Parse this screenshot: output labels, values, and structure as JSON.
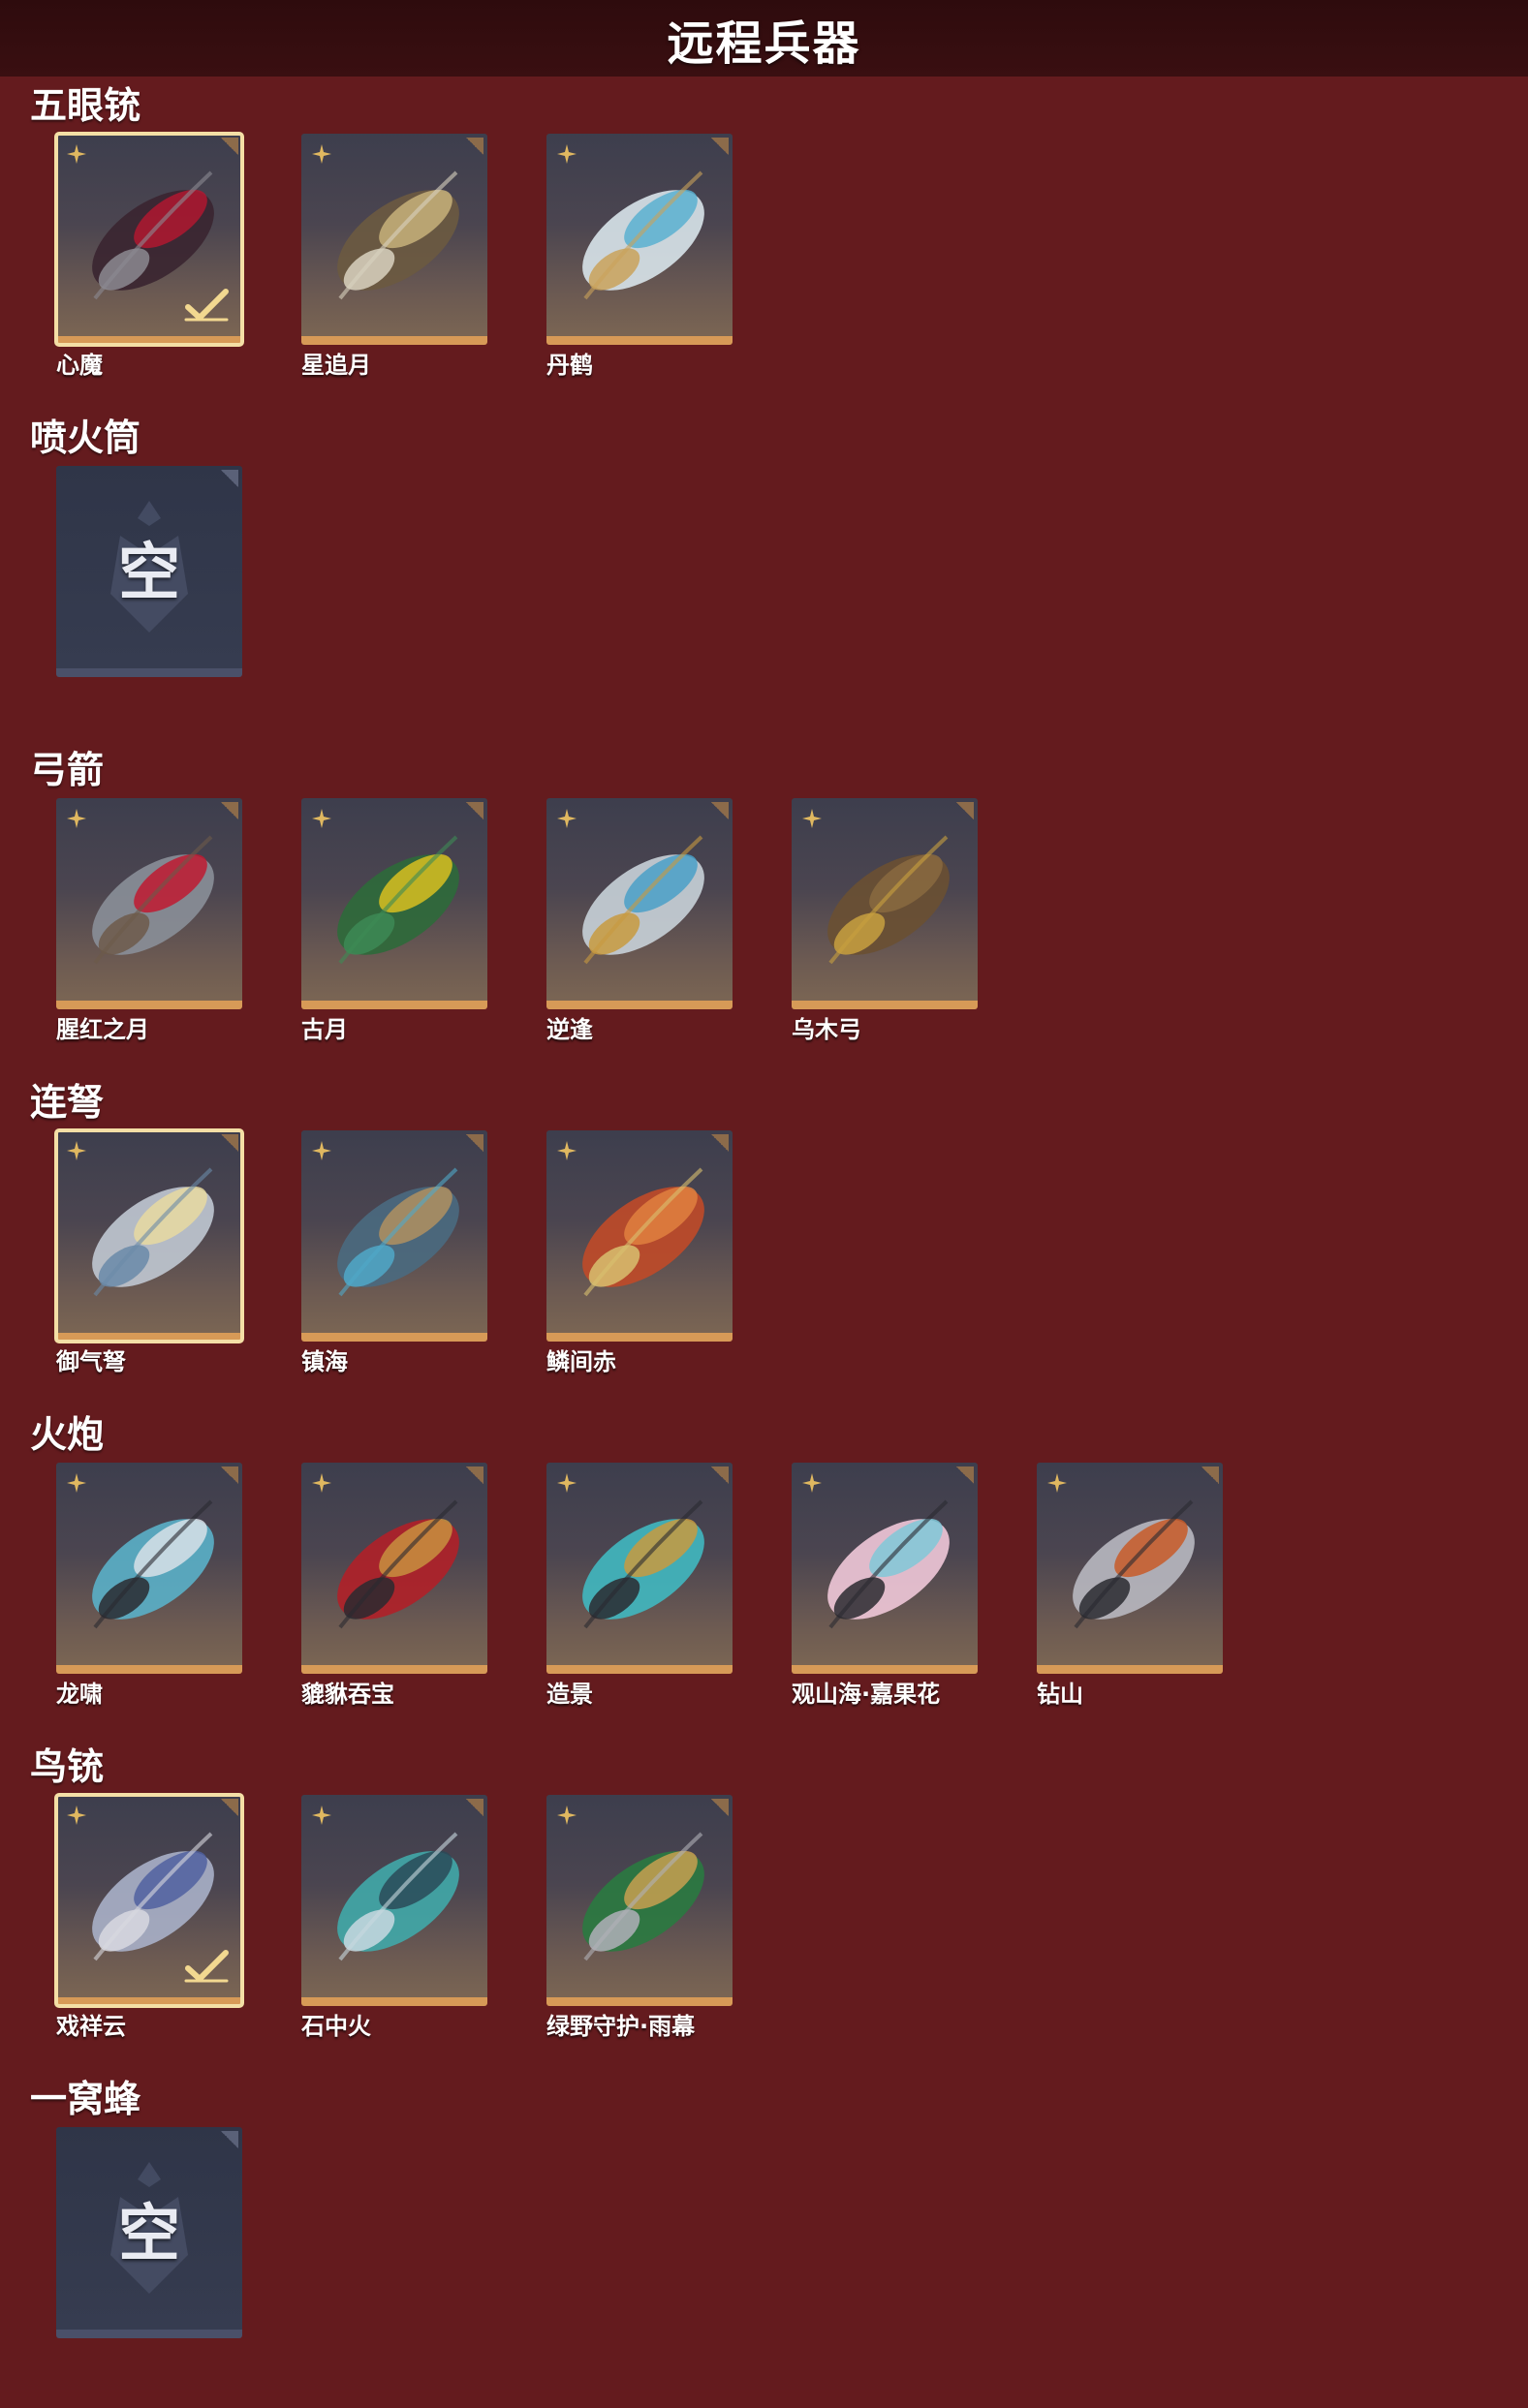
{
  "header": {
    "title": "远程兵器"
  },
  "colors": {
    "background": "#641b1e",
    "header_bg": "#2e0b0d",
    "card_border": "#d79a57",
    "selected_outline": "#f4dfa6",
    "empty_card": "#2f3548"
  },
  "sections": [
    {
      "title": "五眼铳",
      "items": [
        {
          "name": "心魔",
          "selected": true,
          "checked": true,
          "empty": false,
          "art": [
            "#3a2530",
            "#b01830",
            "#8c8a92"
          ]
        },
        {
          "name": "星追月",
          "selected": false,
          "checked": false,
          "empty": false,
          "art": [
            "#6b5a40",
            "#c8b27a",
            "#d9d2c0"
          ]
        },
        {
          "name": "丹鹤",
          "selected": false,
          "checked": false,
          "empty": false,
          "art": [
            "#d8e4ea",
            "#5ab0d0",
            "#c9a25a"
          ]
        }
      ]
    },
    {
      "title": "喷火筒",
      "items": [
        {
          "name": "",
          "selected": false,
          "checked": false,
          "empty": true,
          "empty_label": "空"
        }
      ]
    },
    {
      "title": "弓箭",
      "items": [
        {
          "name": "腥红之月",
          "selected": false,
          "checked": false,
          "empty": false,
          "art": [
            "#8a8f98",
            "#c01a30",
            "#6d5a4a"
          ]
        },
        {
          "name": "古月",
          "selected": false,
          "checked": false,
          "empty": false,
          "art": [
            "#2e6a3a",
            "#d8c020",
            "#3d8a55"
          ]
        },
        {
          "name": "逆逢",
          "selected": false,
          "checked": false,
          "empty": false,
          "art": [
            "#c8d2d8",
            "#4aa0c8",
            "#c89a40"
          ]
        },
        {
          "name": "乌木弓",
          "selected": false,
          "checked": false,
          "empty": false,
          "art": [
            "#6a5032",
            "#8a6a40",
            "#c8a040"
          ]
        }
      ]
    },
    {
      "title": "连弩",
      "items": [
        {
          "name": "御气弩",
          "selected": true,
          "checked": false,
          "empty": false,
          "art": [
            "#c0c8d2",
            "#e8d9a0",
            "#6a8aa8"
          ]
        },
        {
          "name": "镇海",
          "selected": false,
          "checked": false,
          "empty": false,
          "art": [
            "#4a6a80",
            "#b09060",
            "#50a8c8"
          ]
        },
        {
          "name": "鳞间赤",
          "selected": false,
          "checked": false,
          "empty": false,
          "art": [
            "#c04a28",
            "#e08040",
            "#d8c070"
          ]
        }
      ]
    },
    {
      "title": "火炮",
      "items": [
        {
          "name": "龙啸",
          "selected": false,
          "checked": false,
          "empty": false,
          "art": [
            "#5ab0c8",
            "#d8e0e8",
            "#2a2a30"
          ]
        },
        {
          "name": "貔貅吞宝",
          "selected": false,
          "checked": false,
          "empty": false,
          "art": [
            "#b02028",
            "#c89040",
            "#2a2a30"
          ]
        },
        {
          "name": "造景",
          "selected": false,
          "checked": false,
          "empty": false,
          "art": [
            "#40b8c0",
            "#c89a40",
            "#2a2a30"
          ]
        },
        {
          "name": "观山海·嘉果花",
          "selected": false,
          "checked": false,
          "empty": false,
          "art": [
            "#f0c8d8",
            "#80c8d8",
            "#2a2a30"
          ]
        },
        {
          "name": "钻山",
          "selected": false,
          "checked": false,
          "empty": false,
          "art": [
            "#b8b8c0",
            "#c85a28",
            "#2a2a30"
          ]
        }
      ]
    },
    {
      "title": "鸟铳",
      "items": [
        {
          "name": "戏祥云",
          "selected": true,
          "checked": true,
          "empty": false,
          "art": [
            "#a8b0c8",
            "#5060a0",
            "#d8d8e0"
          ]
        },
        {
          "name": "石中火",
          "selected": false,
          "checked": false,
          "empty": false,
          "art": [
            "#40a8a8",
            "#2a4a58",
            "#c8d8e0"
          ]
        },
        {
          "name": "绿野守护·雨幕",
          "selected": false,
          "checked": false,
          "empty": false,
          "art": [
            "#2a7a40",
            "#c8a050",
            "#b0b0b8"
          ]
        }
      ]
    },
    {
      "title": "一窝蜂",
      "items": [
        {
          "name": "",
          "selected": false,
          "checked": false,
          "empty": true,
          "empty_label": "空"
        }
      ]
    }
  ]
}
